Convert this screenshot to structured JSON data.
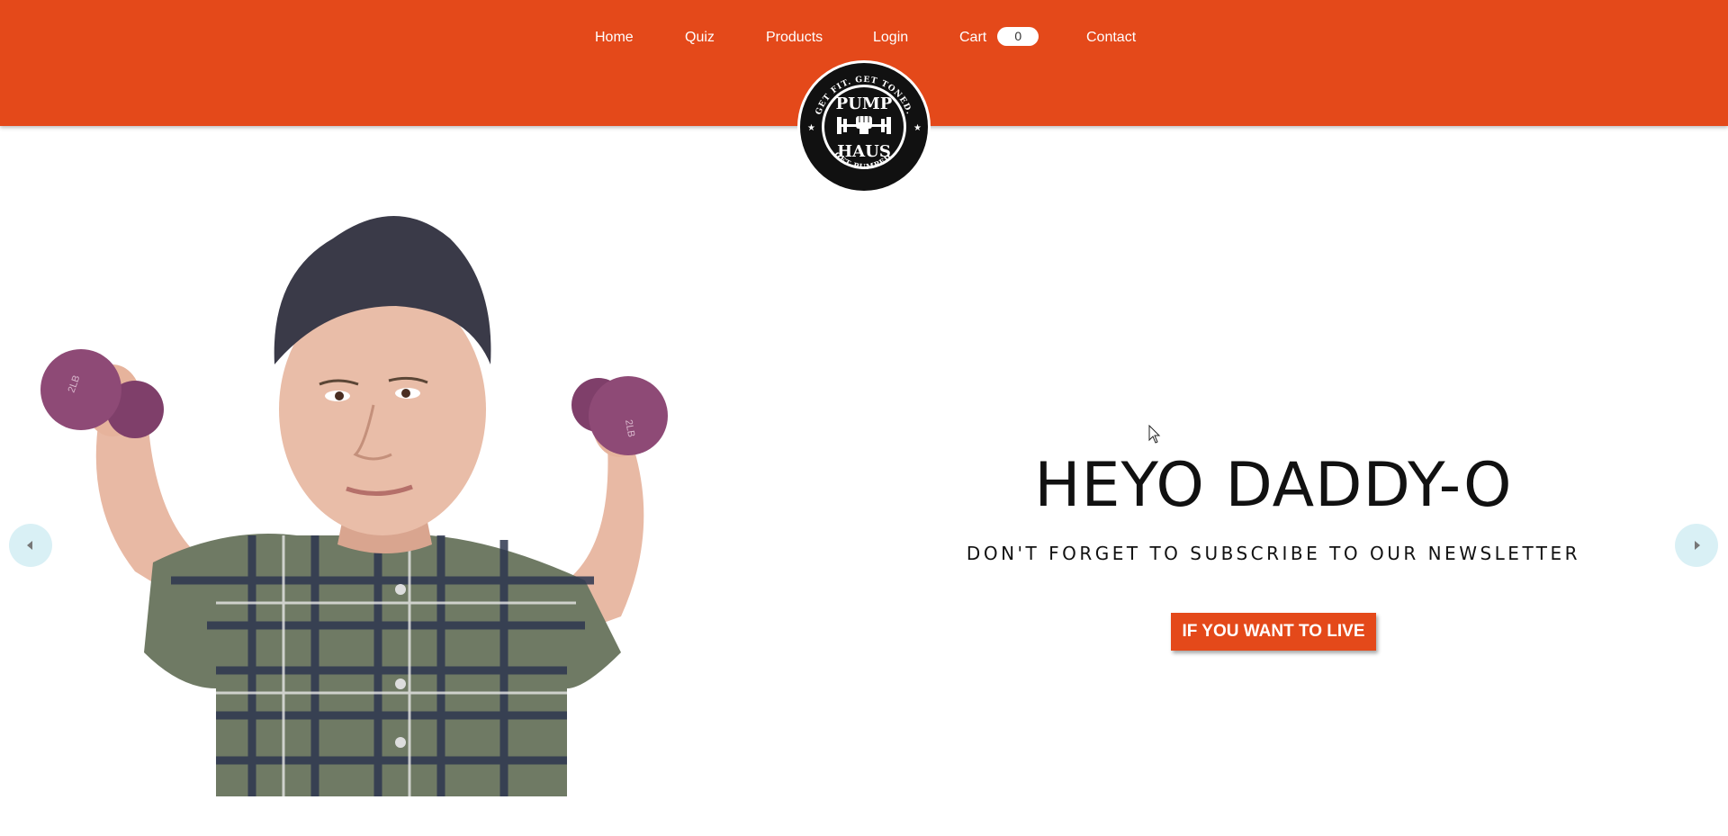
{
  "nav": {
    "home": "Home",
    "quiz": "Quiz",
    "products": "Products",
    "login": "Login",
    "cart": "Cart",
    "cart_count": "0",
    "contact": "Contact"
  },
  "logo": {
    "name_line1": "PUMP",
    "name_line2": "HAUS",
    "top_slogan": "GET FIT. GET TONED.",
    "bottom_slogan": "GET PUMPED.",
    "icon": "fist-barbell-icon"
  },
  "hero": {
    "title": "HEYO DADDY-O",
    "subtitle": "DON'T FORGET TO SUBSCRIBE TO OUR NEWSLETTER",
    "button_label": "IF YOU WANT TO LIVE",
    "dumbbell_label": "2LB"
  },
  "carousel": {
    "prev_icon": "chevron-left-icon",
    "next_icon": "chevron-right-icon"
  },
  "colors": {
    "brand": "#e4491a",
    "arrow_bg": "#d9f0f5",
    "dumbbell": "#8e4a76"
  }
}
